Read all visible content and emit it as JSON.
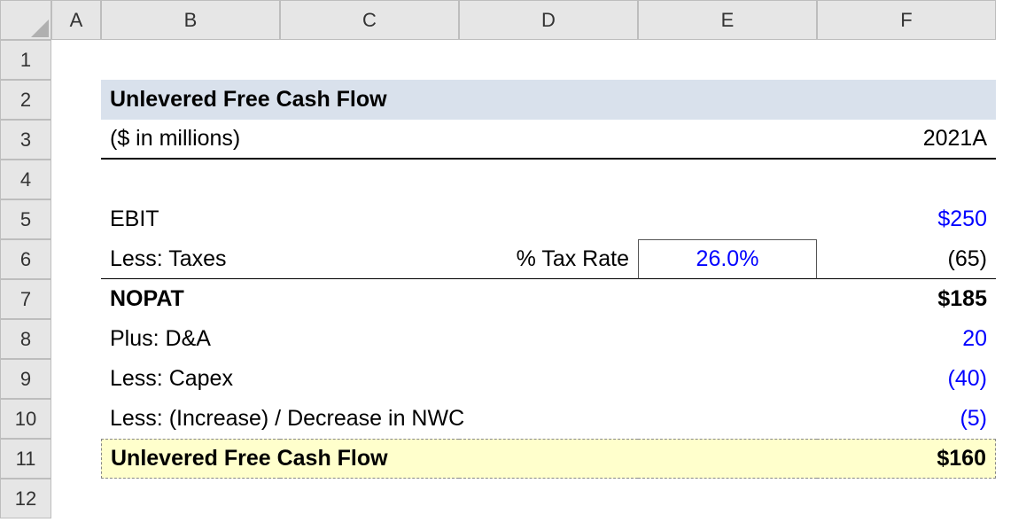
{
  "columns": [
    "A",
    "B",
    "C",
    "D",
    "E",
    "F"
  ],
  "rows": [
    "1",
    "2",
    "3",
    "4",
    "5",
    "6",
    "7",
    "8",
    "9",
    "10",
    "11",
    "12"
  ],
  "cells": {
    "B2": "Unlevered Free Cash Flow",
    "B3": "($ in millions)",
    "F3": "2021A",
    "B5": "EBIT",
    "F5": "$250",
    "B6": "Less: Taxes",
    "D6": "% Tax Rate",
    "E6": "26.0%",
    "F6": "(65)",
    "B7": "NOPAT",
    "F7": "$185",
    "B8": "Plus: D&A",
    "F8": "20",
    "B9": "Less: Capex",
    "F9": "(40)",
    "B10": "Less: (Increase) / Decrease in NWC",
    "F10": "(5)",
    "B11": "Unlevered Free Cash Flow",
    "F11": "$160"
  }
}
